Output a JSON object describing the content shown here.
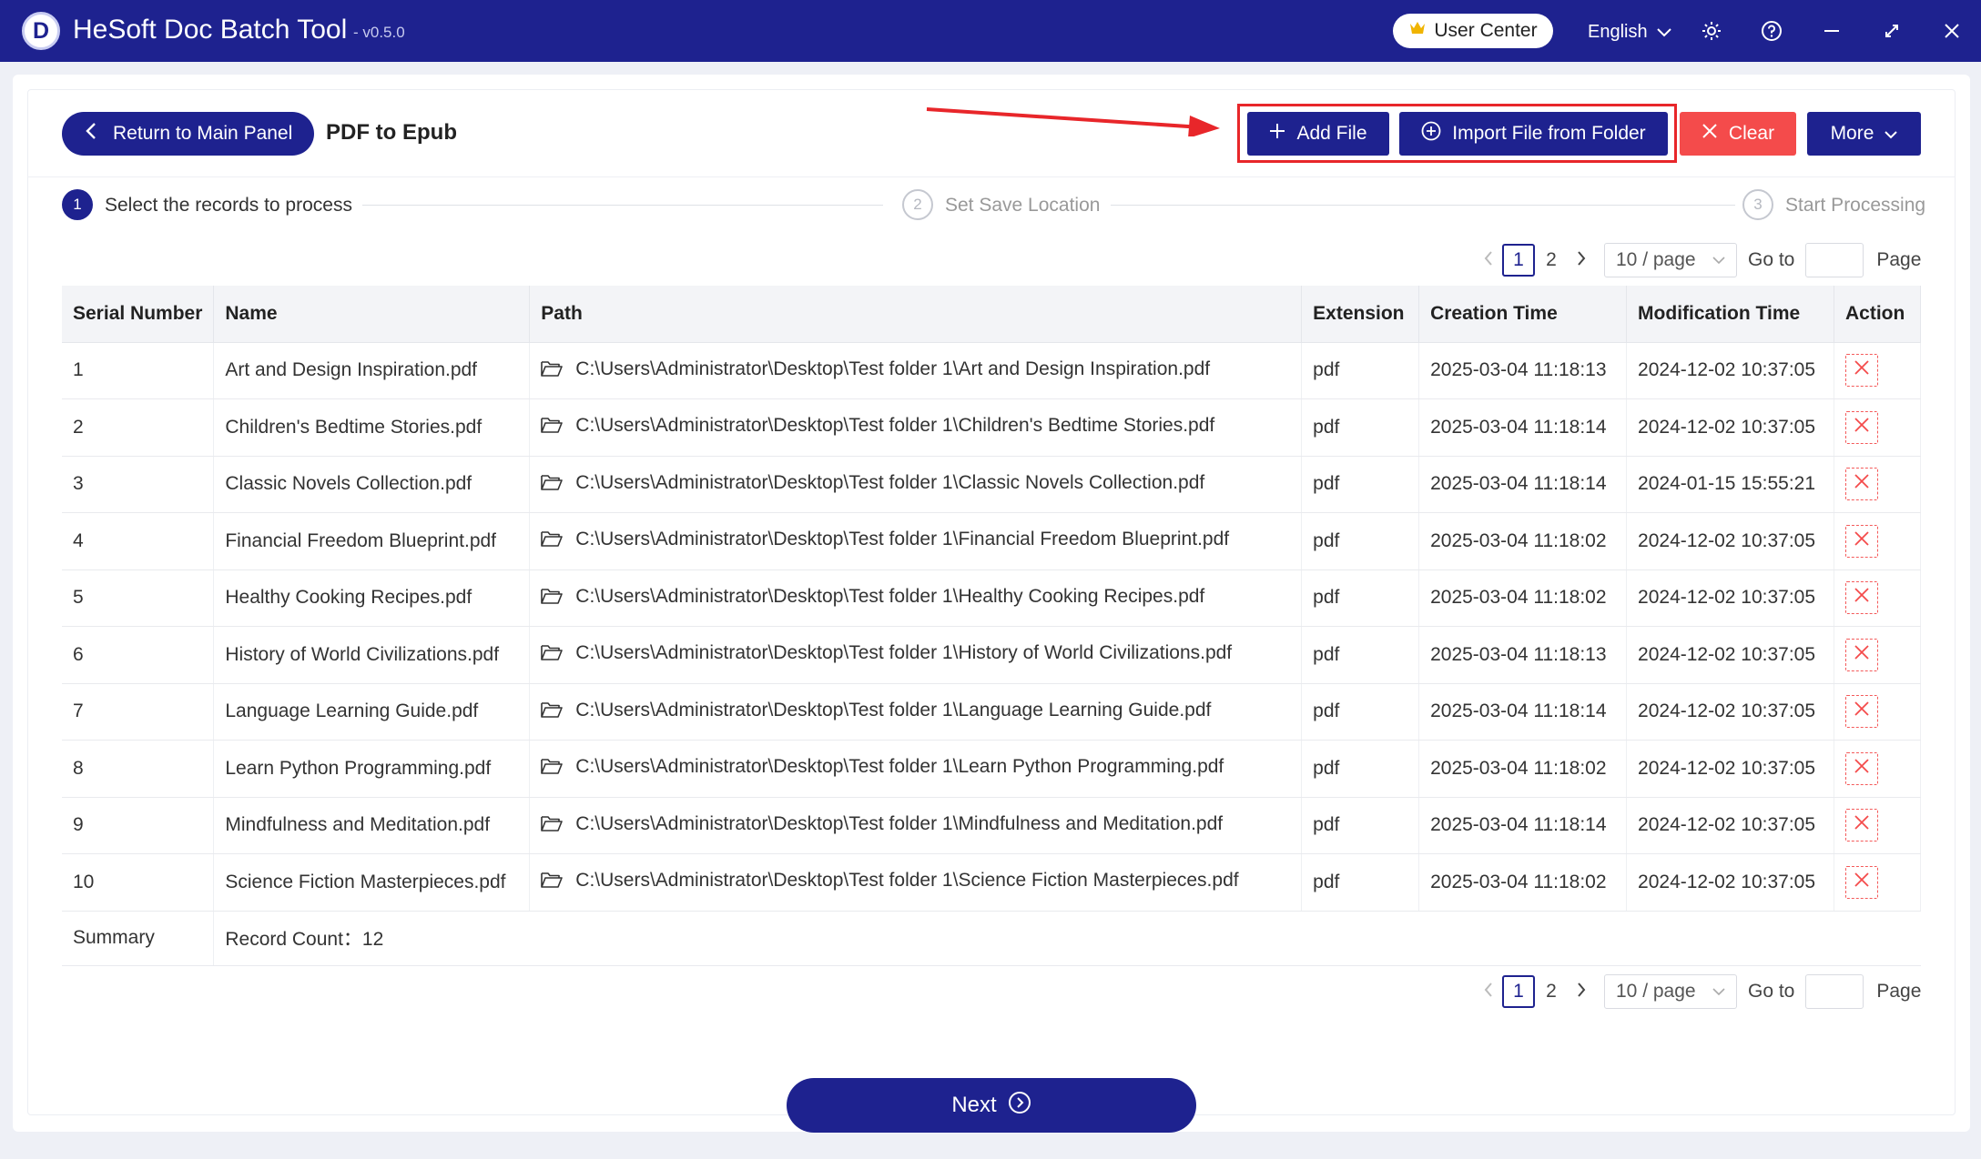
{
  "app": {
    "title": "HeSoft Doc Batch Tool",
    "version": "- v0.5.0",
    "logo_letter": "D",
    "user_center": "User Center",
    "language": "English",
    "brand_color": "#1e228f"
  },
  "header": {
    "back_label": "Return to Main Panel",
    "page_title": "PDF to Epub",
    "add_file": "Add File",
    "import_folder": "Import File from Folder",
    "clear": "Clear",
    "more": "More"
  },
  "steps": [
    {
      "num": "1",
      "label": "Select the records to process",
      "active": true
    },
    {
      "num": "2",
      "label": "Set Save Location",
      "active": false
    },
    {
      "num": "3",
      "label": "Start Processing",
      "active": false
    }
  ],
  "pagination": {
    "pages": [
      "1",
      "2"
    ],
    "current": "1",
    "page_size": "10 / page",
    "goto_label": "Go to",
    "page_label": "Page"
  },
  "table": {
    "columns": [
      "Serial Number",
      "Name",
      "Path",
      "Extension",
      "Creation Time",
      "Modification Time",
      "Action"
    ],
    "rows": [
      {
        "sn": "1",
        "name": "Art and Design Inspiration.pdf",
        "path": "C:\\Users\\Administrator\\Desktop\\Test folder 1\\Art and Design Inspiration.pdf",
        "ext": "pdf",
        "created": "2025-03-04 11:18:13",
        "modified": "2024-12-02 10:37:05"
      },
      {
        "sn": "2",
        "name": "Children's Bedtime Stories.pdf",
        "path": "C:\\Users\\Administrator\\Desktop\\Test folder 1\\Children's Bedtime Stories.pdf",
        "ext": "pdf",
        "created": "2025-03-04 11:18:14",
        "modified": "2024-12-02 10:37:05"
      },
      {
        "sn": "3",
        "name": "Classic Novels Collection.pdf",
        "path": "C:\\Users\\Administrator\\Desktop\\Test folder 1\\Classic Novels Collection.pdf",
        "ext": "pdf",
        "created": "2025-03-04 11:18:14",
        "modified": "2024-01-15 15:55:21"
      },
      {
        "sn": "4",
        "name": "Financial Freedom Blueprint.pdf",
        "path": "C:\\Users\\Administrator\\Desktop\\Test folder 1\\Financial Freedom Blueprint.pdf",
        "ext": "pdf",
        "created": "2025-03-04 11:18:02",
        "modified": "2024-12-02 10:37:05"
      },
      {
        "sn": "5",
        "name": "Healthy Cooking Recipes.pdf",
        "path": "C:\\Users\\Administrator\\Desktop\\Test folder 1\\Healthy Cooking Recipes.pdf",
        "ext": "pdf",
        "created": "2025-03-04 11:18:02",
        "modified": "2024-12-02 10:37:05"
      },
      {
        "sn": "6",
        "name": "History of World Civilizations.pdf",
        "path": "C:\\Users\\Administrator\\Desktop\\Test folder 1\\History of World Civilizations.pdf",
        "ext": "pdf",
        "created": "2025-03-04 11:18:13",
        "modified": "2024-12-02 10:37:05"
      },
      {
        "sn": "7",
        "name": "Language Learning Guide.pdf",
        "path": "C:\\Users\\Administrator\\Desktop\\Test folder 1\\Language Learning Guide.pdf",
        "ext": "pdf",
        "created": "2025-03-04 11:18:14",
        "modified": "2024-12-02 10:37:05"
      },
      {
        "sn": "8",
        "name": "Learn Python Programming.pdf",
        "path": "C:\\Users\\Administrator\\Desktop\\Test folder 1\\Learn Python Programming.pdf",
        "ext": "pdf",
        "created": "2025-03-04 11:18:02",
        "modified": "2024-12-02 10:37:05"
      },
      {
        "sn": "9",
        "name": "Mindfulness and Meditation.pdf",
        "path": "C:\\Users\\Administrator\\Desktop\\Test folder 1\\Mindfulness and Meditation.pdf",
        "ext": "pdf",
        "created": "2025-03-04 11:18:14",
        "modified": "2024-12-02 10:37:05"
      },
      {
        "sn": "10",
        "name": "Science Fiction Masterpieces.pdf",
        "path": "C:\\Users\\Administrator\\Desktop\\Test folder 1\\Science Fiction Masterpieces.pdf",
        "ext": "pdf",
        "created": "2025-03-04 11:18:02",
        "modified": "2024-12-02 10:37:05"
      }
    ],
    "summary_label": "Summary",
    "record_count": "Record Count：12"
  },
  "footer": {
    "next": "Next"
  }
}
